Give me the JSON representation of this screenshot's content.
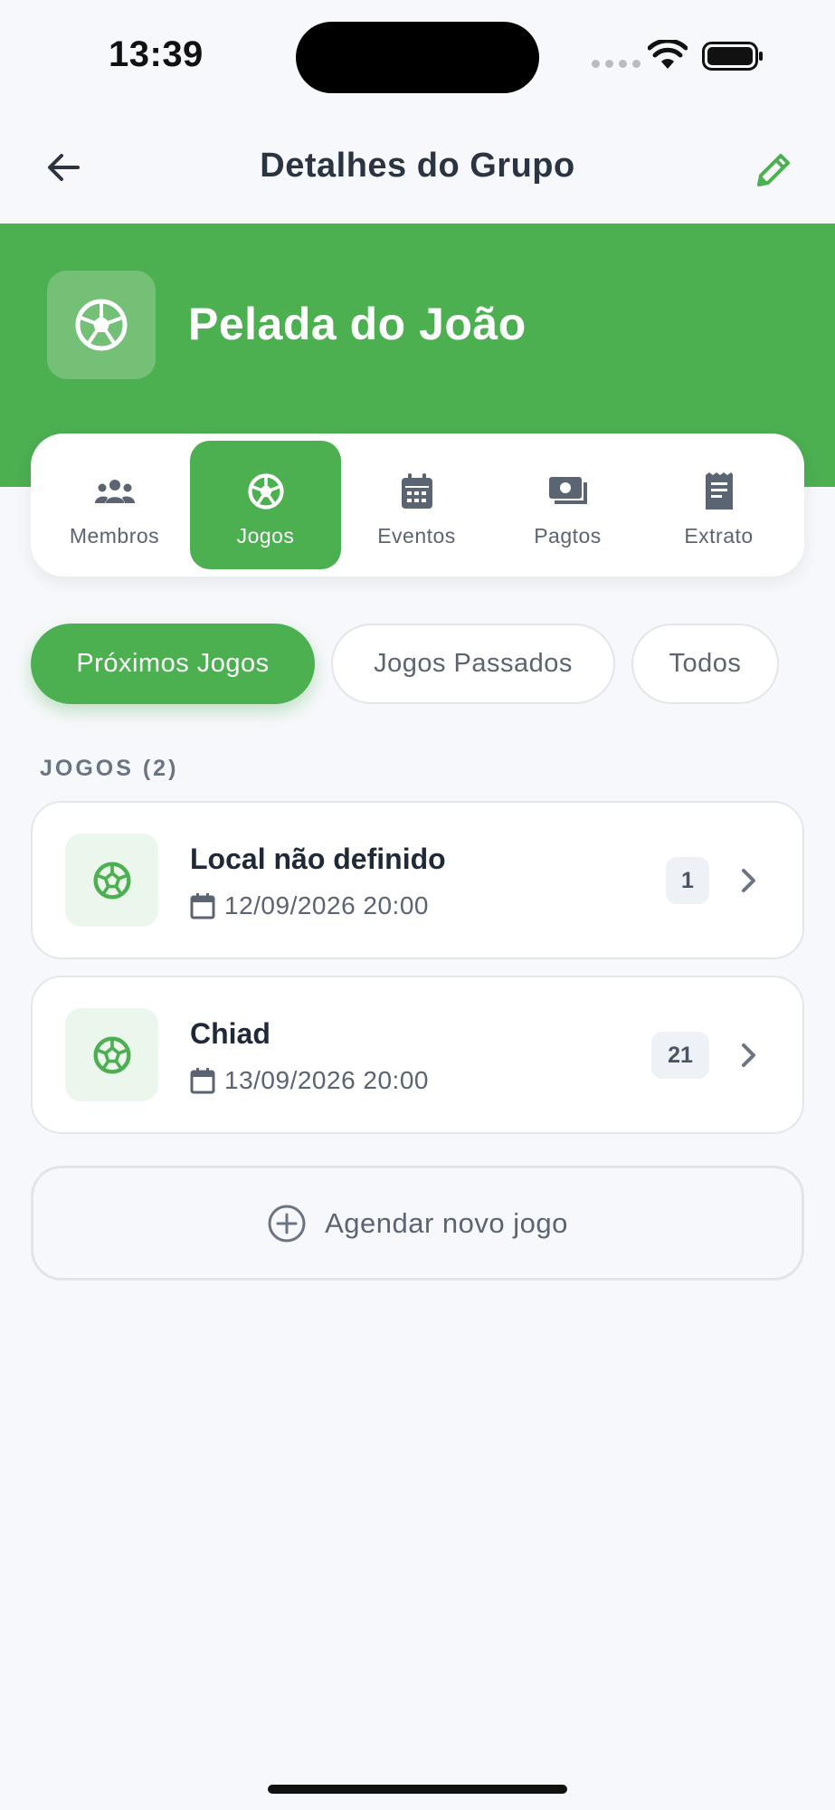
{
  "status_bar": {
    "time": "13:39"
  },
  "header": {
    "title": "Detalhes do Grupo",
    "back_icon": "arrow-left-icon",
    "edit_icon": "pencil-icon"
  },
  "group": {
    "name": "Pelada do João",
    "icon": "soccer-ball-icon"
  },
  "tabs": [
    {
      "label": "Membros",
      "icon": "people-icon",
      "active": false
    },
    {
      "label": "Jogos",
      "icon": "soccer-ball-icon",
      "active": true
    },
    {
      "label": "Eventos",
      "icon": "calendar-icon",
      "active": false
    },
    {
      "label": "Pagtos",
      "icon": "money-icon",
      "active": false
    },
    {
      "label": "Extrato",
      "icon": "receipt-icon",
      "active": false
    }
  ],
  "filters": [
    {
      "label": "Próximos Jogos",
      "active": true
    },
    {
      "label": "Jogos Passados",
      "active": false
    },
    {
      "label": "Todos",
      "active": false
    }
  ],
  "section": {
    "title": "JOGOS (2)"
  },
  "games": [
    {
      "title": "Local não definido",
      "datetime": "12/09/2026 20:00",
      "count": "1"
    },
    {
      "title": "Chiad",
      "datetime": "13/09/2026 20:00",
      "count": "21"
    }
  ],
  "schedule_button": {
    "label": "Agendar novo jogo",
    "icon": "plus-circle-icon"
  },
  "colors": {
    "primary": "#4caf50",
    "background": "#f7f8fb",
    "text": "#1f2937",
    "muted": "#5b6473"
  }
}
